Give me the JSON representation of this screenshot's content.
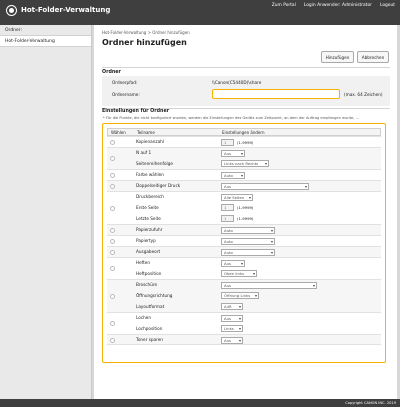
{
  "header": {
    "title": "Hot-Folder-Verwaltung",
    "links": [
      "Zum Portal",
      "Login Anwender: Administrator",
      "Logout"
    ]
  },
  "sidebar": {
    "items": [
      "Ordner:",
      "Hot-Folder-Verwaltung"
    ]
  },
  "main": {
    "breadcrumb": "Hot-Folder-Verwaltung > Ordner hinzufügen",
    "title": "Ordner hinzufügen",
    "buttons": {
      "add": "Hinzufügen",
      "cancel": "Abbrechen"
    },
    "ordner_section": {
      "heading": "Ordner",
      "path_label": "Ordnerpfad:",
      "path_value": "\\\\Canon(C5440D)\\share",
      "name_label": "Ordnername:",
      "name_value": "",
      "name_hint": "(max. 64 Zeichen)"
    },
    "settings_section": {
      "heading": "Einstellungen für Ordner",
      "note": "* Für die Punkte, die nicht konfiguriert wurden, werden die Einstellungen des Geräts zum Zeitpunkt, an dem der Auftrag empfangen wurde, ...",
      "columns": [
        "Wählen",
        "Teilname",
        "Einstellungen ändern"
      ],
      "rows": [
        {
          "label": "Kopienanzahl",
          "value": "1",
          "range": "(1-9999)"
        },
        {
          "label": "N auf 1",
          "value": "Aus"
        },
        {
          "label": "Seitenreihenfolge",
          "value": "Links nach Rechts"
        },
        {
          "label": "Farbe wählen",
          "value": "Auto"
        },
        {
          "label": "Doppelseitiger Druck",
          "value": "Aus"
        },
        {
          "label": "Druckbereich",
          "value": "Alle Seiten"
        },
        {
          "label": "Erste Seite",
          "value": "1",
          "range": "(1-9999)"
        },
        {
          "label": "Letzte Seite",
          "value": "1",
          "range": "(1-9999)"
        },
        {
          "label": "Papierzufuhr",
          "value": "Auto"
        },
        {
          "label": "Papiertyp",
          "value": "Auto"
        },
        {
          "label": "Ausgabeort",
          "value": "Auto"
        },
        {
          "label": "Heften",
          "value": "Aus"
        },
        {
          "label": "Heftposition",
          "value": "Oben links"
        },
        {
          "label": "Broschüre",
          "value": "Aus"
        },
        {
          "label": "Öffnungsrichtung",
          "value": "Öffnung Links"
        },
        {
          "label": "Layoutformat",
          "value": "A4R"
        },
        {
          "label": "Lochen",
          "value": "Aus"
        },
        {
          "label": "Lochposition",
          "value": "Links"
        },
        {
          "label": "Toner sparen",
          "value": "Aus"
        }
      ]
    }
  },
  "footer": {
    "copyright": "Copyright CANON INC. 2019"
  }
}
